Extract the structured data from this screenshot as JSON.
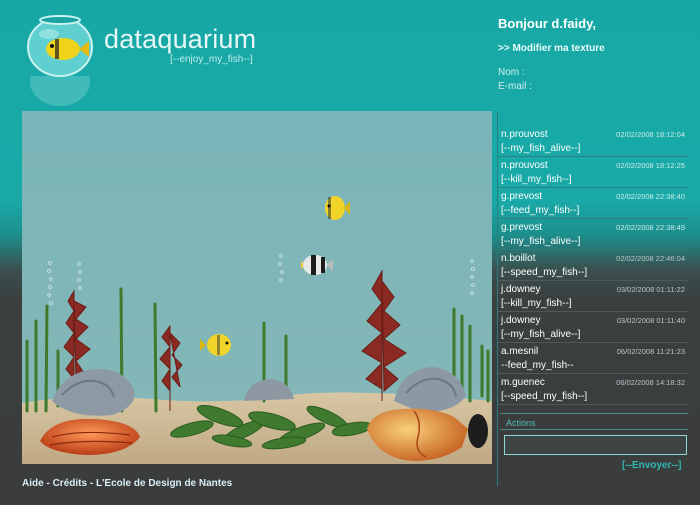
{
  "header": {
    "brand": "dataquarium",
    "tagline": "[--enjoy_my_fish--]"
  },
  "user": {
    "greeting": "Bonjour d.faidy,",
    "modify_link": ">> Modifier ma texture",
    "nom_label": "Nom :",
    "email_label": "E-mail :"
  },
  "messages": [
    {
      "author": "n.prouvost",
      "time": "02/02/2008 18:12:04",
      "action": "[--my_fish_alive--]"
    },
    {
      "author": "n.prouvost",
      "time": "02/02/2008 18:12:25",
      "action": "[--kill_my_fish--]"
    },
    {
      "author": "g.prevost",
      "time": "02/02/2008 22:38:40",
      "action": "[--feed_my_fish--]"
    },
    {
      "author": "g.prevost",
      "time": "02/02/2008 22:38:49",
      "action": "[--my_fish_alive--]"
    },
    {
      "author": "n.boillot",
      "time": "02/02/2008 22:46:04",
      "action": "[--speed_my_fish--]"
    },
    {
      "author": "j.downey",
      "time": "03/02/2008 01:11:22",
      "action": "[--kill_my_fish--]"
    },
    {
      "author": "j.downey",
      "time": "03/02/2008 01:11:40",
      "action": "[--my_fish_alive--]"
    },
    {
      "author": "a.mesnil",
      "time": "06/02/2008 11:21:23",
      "action": "--feed_my_fish--"
    },
    {
      "author": "m.guenec",
      "time": "06/02/2008 14:18:32",
      "action": "[--speed_my_fish--]"
    }
  ],
  "actions": {
    "label": "Actions",
    "input_value": "",
    "send_label": "[--Envoyer--]"
  },
  "footer": {
    "aide": "Aide",
    "credits": "Crédits",
    "school": "L'Ecole de Design de Nantes",
    "separator": "-"
  },
  "colors": {
    "background_top": "#17a8a6",
    "background_bottom": "#3b3c3c",
    "water": "#7ab3b6",
    "accent": "#2fb7b4"
  }
}
